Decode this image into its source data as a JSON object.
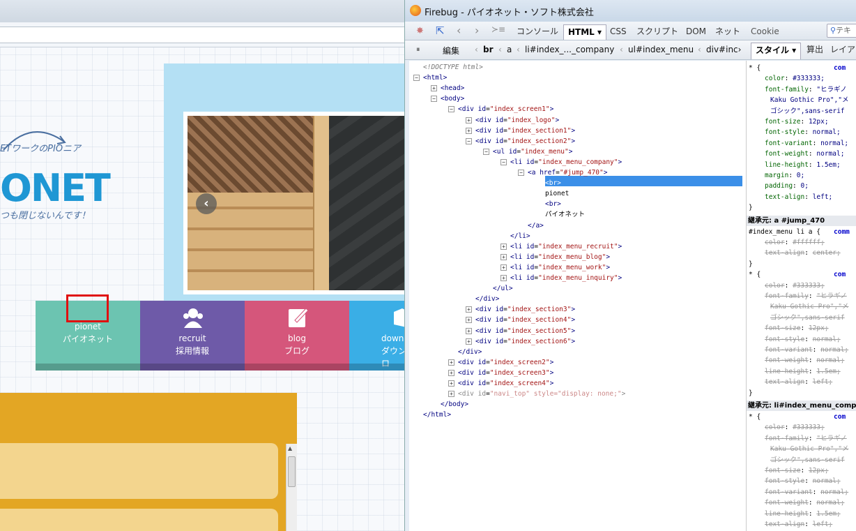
{
  "browser": {
    "url": ""
  },
  "page": {
    "logo": {
      "tagline": "ETワークのPIOニア",
      "main": "ONET",
      "sub": "つも閉じないんです！"
    },
    "carousel": {
      "prev_icon": "‹"
    },
    "menu": [
      {
        "en": "pionet",
        "ja": "パイオネット",
        "color": "#6cc4b1"
      },
      {
        "en": "recruit",
        "ja": "採用情報",
        "color": "#6e5aa8"
      },
      {
        "en": "blog",
        "ja": "ブログ",
        "color": "#d5567b"
      },
      {
        "en": "down",
        "ja": "ダウンロ",
        "color": "#3aaee6"
      }
    ]
  },
  "firebug": {
    "title": "Firebug - パイオネット・ソフト株式会社",
    "tabs": [
      "コンソール",
      "HTML ▾",
      "CSS",
      "スクリプト",
      "DOM",
      "ネット",
      "Cookie"
    ],
    "search_placeholder": "テキ",
    "edit_label": "編集",
    "breadcrumbs": [
      "br",
      "a",
      "li#index_..._company",
      "ul#index_menu",
      "div#inc›"
    ],
    "side_tabs": [
      "スタイル ▾",
      "算出",
      "レイア"
    ],
    "tree": [
      {
        "d": 0,
        "text": "<!DOCTYPE html>",
        "dt": true
      },
      {
        "d": 0,
        "tw": "−",
        "tag": "<html>"
      },
      {
        "d": 1,
        "tw": "+",
        "tag": "<head>"
      },
      {
        "d": 1,
        "tw": "−",
        "tag": "<body>"
      },
      {
        "d": 2,
        "tw": "−",
        "tag": "<div",
        "attr": "id",
        "val": "\"index_screen1\"",
        "end": ">"
      },
      {
        "d": 3,
        "tw": "+",
        "tag": "<div",
        "attr": "id",
        "val": "\"index_logo\"",
        "end": ">"
      },
      {
        "d": 3,
        "tw": "+",
        "tag": "<div",
        "attr": "id",
        "val": "\"index_section1\"",
        "end": ">"
      },
      {
        "d": 3,
        "tw": "−",
        "tag": "<div",
        "attr": "id",
        "val": "\"index_section2\"",
        "end": ">"
      },
      {
        "d": 4,
        "tw": "−",
        "tag": "<ul",
        "attr": "id",
        "val": "\"index_menu\"",
        "end": ">"
      },
      {
        "d": 5,
        "tw": "−",
        "tag": "<li",
        "attr": "id",
        "val": "\"index_menu_company\"",
        "end": ">"
      },
      {
        "d": 6,
        "tw": "−",
        "tag": "<a",
        "attr": "href",
        "val": "\"#jump_470\"",
        "end": ">"
      },
      {
        "d": 7,
        "tag": "<br>",
        "sel": true
      },
      {
        "d": 7,
        "text": "pionet"
      },
      {
        "d": 7,
        "tag": "<br>"
      },
      {
        "d": 7,
        "text": "パイオネット"
      },
      {
        "d": 6,
        "tag": "</a>"
      },
      {
        "d": 5,
        "tag": "</li>"
      },
      {
        "d": 5,
        "tw": "+",
        "tag": "<li",
        "attr": "id",
        "val": "\"index_menu_recruit\"",
        "end": ">"
      },
      {
        "d": 5,
        "tw": "+",
        "tag": "<li",
        "attr": "id",
        "val": "\"index_menu_blog\"",
        "end": ">"
      },
      {
        "d": 5,
        "tw": "+",
        "tag": "<li",
        "attr": "id",
        "val": "\"index_menu_work\"",
        "end": ">"
      },
      {
        "d": 5,
        "tw": "+",
        "tag": "<li",
        "attr": "id",
        "val": "\"index_menu_inquiry\"",
        "end": ">"
      },
      {
        "d": 4,
        "tag": "</ul>"
      },
      {
        "d": 3,
        "tag": "</div>"
      },
      {
        "d": 3,
        "tw": "+",
        "tag": "<div",
        "attr": "id",
        "val": "\"index_section3\"",
        "end": ">"
      },
      {
        "d": 3,
        "tw": "+",
        "tag": "<div",
        "attr": "id",
        "val": "\"index_section4\"",
        "end": ">"
      },
      {
        "d": 3,
        "tw": "+",
        "tag": "<div",
        "attr": "id",
        "val": "\"index_section5\"",
        "end": ">"
      },
      {
        "d": 3,
        "tw": "+",
        "tag": "<div",
        "attr": "id",
        "val": "\"index_section6\"",
        "end": ">"
      },
      {
        "d": 2,
        "tag": "</div>"
      },
      {
        "d": 2,
        "tw": "+",
        "tag": "<div",
        "attr": "id",
        "val": "\"index_screen2\"",
        "end": ">"
      },
      {
        "d": 2,
        "tw": "+",
        "tag": "<div",
        "attr": "id",
        "val": "\"index_screen3\"",
        "end": ">"
      },
      {
        "d": 2,
        "tw": "+",
        "tag": "<div",
        "attr": "id",
        "val": "\"index_screen4\"",
        "end": ">"
      },
      {
        "d": 2,
        "tw": "+",
        "tag": "<div",
        "attr": "id",
        "val": "\"navi_top\" style=\"display: none;\"",
        "end": ">",
        "grey": true
      },
      {
        "d": 1,
        "tag": "</body>"
      },
      {
        "d": 0,
        "tag": "</html>"
      }
    ],
    "styles": [
      {
        "k": "rule",
        "sel": "* {",
        "src": "com"
      },
      {
        "k": "prop",
        "n": "color",
        "v": "#333333;"
      },
      {
        "k": "prop",
        "n": "font-family",
        "v": "\"ヒラギノ"
      },
      {
        "k": "cont",
        "v": "Kaku Gothic Pro\",\"メ"
      },
      {
        "k": "cont",
        "v": "ゴシック\",sans-serif"
      },
      {
        "k": "prop",
        "n": "font-size",
        "v": "12px;"
      },
      {
        "k": "prop",
        "n": "font-style",
        "v": "normal;"
      },
      {
        "k": "prop",
        "n": "font-variant",
        "v": "normal;"
      },
      {
        "k": "prop",
        "n": "font-weight",
        "v": "normal;"
      },
      {
        "k": "prop",
        "n": "line-height",
        "v": "1.5em;"
      },
      {
        "k": "prop",
        "n": "margin",
        "v": "0;"
      },
      {
        "k": "prop",
        "n": "padding",
        "v": "0;"
      },
      {
        "k": "prop",
        "n": "text-align",
        "v": "left;"
      },
      {
        "k": "close",
        "v": "}"
      },
      {
        "k": "inh",
        "v": "継承元: a #jump_470"
      },
      {
        "k": "rule",
        "sel": "#index_menu li a {",
        "src": "comm"
      },
      {
        "k": "prop",
        "n": "color",
        "v": "#ffffff;",
        "s": true
      },
      {
        "k": "prop",
        "n": "text-align",
        "v": "center;",
        "s": true
      },
      {
        "k": "close",
        "v": "}"
      },
      {
        "k": "rule",
        "sel": "* {",
        "src": "com"
      },
      {
        "k": "prop",
        "n": "color",
        "v": "#333333;",
        "s": true
      },
      {
        "k": "prop",
        "n": "font-family",
        "v": "\"ヒラギノ",
        "s": true
      },
      {
        "k": "cont",
        "v": "Kaku Gothic Pro\",\"メ",
        "s": true
      },
      {
        "k": "cont",
        "v": "ゴシック\",sans-serif",
        "s": true
      },
      {
        "k": "prop",
        "n": "font-size",
        "v": "12px;",
        "s": true
      },
      {
        "k": "prop",
        "n": "font-style",
        "v": "normal;",
        "s": true
      },
      {
        "k": "prop",
        "n": "font-variant",
        "v": "normal;",
        "s": true
      },
      {
        "k": "prop",
        "n": "font-weight",
        "v": "normal;",
        "s": true
      },
      {
        "k": "prop",
        "n": "line-height",
        "v": "1.5em;",
        "s": true
      },
      {
        "k": "prop",
        "n": "text-align",
        "v": "left;",
        "s": true
      },
      {
        "k": "close",
        "v": "}"
      },
      {
        "k": "inh",
        "v": "継承元: li#index_menu_comp"
      },
      {
        "k": "rule",
        "sel": "* {",
        "src": "com"
      },
      {
        "k": "prop",
        "n": "color",
        "v": "#333333;",
        "s": true
      },
      {
        "k": "prop",
        "n": "font-family",
        "v": "\"ヒラギノ",
        "s": true
      },
      {
        "k": "cont",
        "v": "Kaku Gothic Pro\",\"メ",
        "s": true
      },
      {
        "k": "cont",
        "v": "ゴシック\",sans-serif",
        "s": true
      },
      {
        "k": "prop",
        "n": "font-size",
        "v": "12px;",
        "s": true
      },
      {
        "k": "prop",
        "n": "font-style",
        "v": "normal;",
        "s": true
      },
      {
        "k": "prop",
        "n": "font-variant",
        "v": "normal;",
        "s": true
      },
      {
        "k": "prop",
        "n": "font-weight",
        "v": "normal;",
        "s": true
      },
      {
        "k": "prop",
        "n": "line-height",
        "v": "1.5em;",
        "s": true
      },
      {
        "k": "prop",
        "n": "text-align",
        "v": "left;",
        "s": true
      }
    ]
  }
}
